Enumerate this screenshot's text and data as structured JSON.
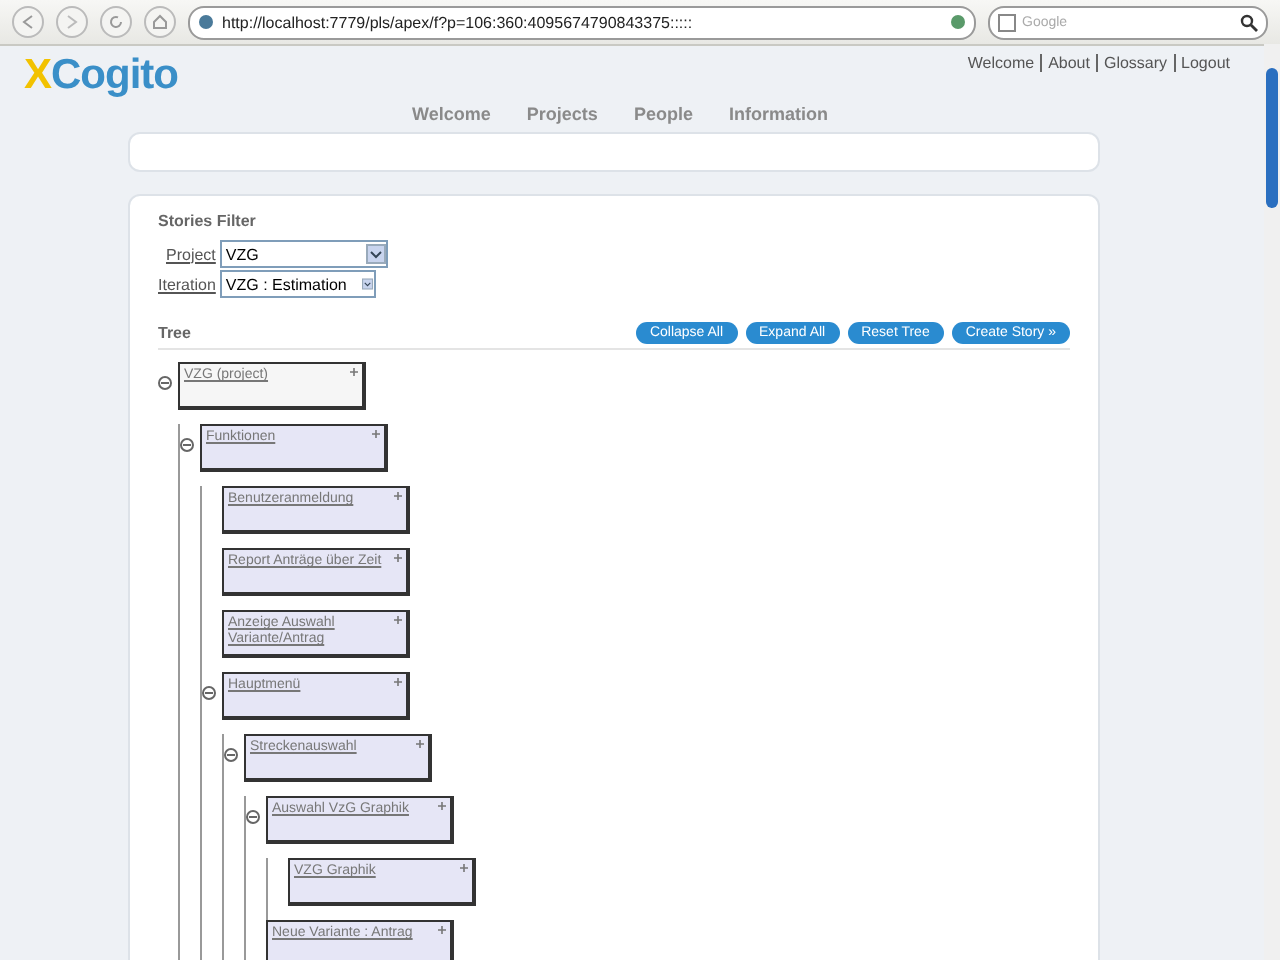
{
  "browser": {
    "url": "http://localhost:7779/pls/apex/f?p=106:360:4095674790843375:::::",
    "search_placeholder": "Google"
  },
  "header": {
    "logo": {
      "first": "X",
      "rest": "Cogito"
    },
    "top_links": [
      "Welcome",
      "About",
      "Glossary",
      "Logout"
    ]
  },
  "nav": [
    "Welcome",
    "Projects",
    "People",
    "Information"
  ],
  "filter": {
    "title": "Stories Filter",
    "fields": [
      {
        "label": "Project",
        "value": "VZG"
      },
      {
        "label": "Iteration",
        "value": "VZG : Estimation"
      }
    ]
  },
  "tree": {
    "title": "Tree",
    "buttons": [
      "Collapse All",
      "Expand All",
      "Reset Tree",
      "Create Story »"
    ],
    "nodes": [
      {
        "label": "VZG (project)",
        "kind": "project",
        "expanded": true,
        "children": [
          {
            "label": "Funktionen",
            "kind": "story",
            "expanded": true,
            "children": [
              {
                "label": "Benutzeranmeldung",
                "kind": "story"
              },
              {
                "label": "Report Anträge über Zeit",
                "kind": "story"
              },
              {
                "label": "Anzeige Auswahl Variante/Antrag",
                "kind": "story"
              },
              {
                "label": "Hauptmenü",
                "kind": "story",
                "expanded": true,
                "children": [
                  {
                    "label": "Streckenauswahl",
                    "kind": "story",
                    "expanded": true,
                    "children": [
                      {
                        "label": "Auswahl VzG Graphik",
                        "kind": "story",
                        "expanded": true,
                        "children": [
                          {
                            "label": "VZG Graphik",
                            "kind": "story"
                          }
                        ]
                      },
                      {
                        "label": "Neue Variante : Antrag",
                        "kind": "story"
                      }
                    ]
                  }
                ]
              }
            ]
          }
        ]
      }
    ]
  }
}
